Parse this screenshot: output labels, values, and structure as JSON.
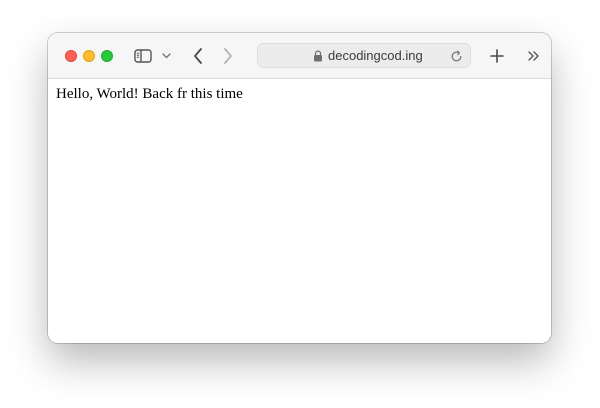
{
  "browser": {
    "address_bar": {
      "url": "decodingcod.ing"
    },
    "toolbar": {
      "icons": [
        "close",
        "minimize",
        "zoom",
        "sidebar-icon",
        "chevron-down-icon",
        "back-icon",
        "forward-icon",
        "lock-icon",
        "reload-icon",
        "plus-icon",
        "double-chevron-right-icon"
      ]
    }
  },
  "page": {
    "body_text": "Hello, World! Back fr this time"
  },
  "colors": {
    "traffic_red": "#fe5f57",
    "traffic_yellow": "#febc2e",
    "traffic_green": "#28c840",
    "toolbar_bg": "#f6f6f6",
    "address_bg": "#ececec"
  }
}
